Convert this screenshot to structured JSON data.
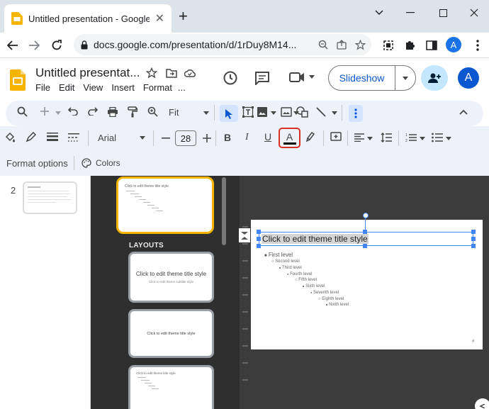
{
  "browser": {
    "tab_title": "Untitled presentation - Google Sl",
    "url": "docs.google.com/presentation/d/1rDuy8M14...",
    "avatar_letter": "A"
  },
  "docs": {
    "title": "Untitled presentat...",
    "menu": [
      "File",
      "Edit",
      "View",
      "Insert",
      "Format",
      "..."
    ],
    "slideshow_label": "Slideshow",
    "avatar_letter": "A"
  },
  "toolbar": {
    "zoom": "Fit",
    "font": "Arial",
    "font_size": "28"
  },
  "format_bar": {
    "format_options": "Format options",
    "colors": "Colors"
  },
  "filmstrip": {
    "slide_number": "2"
  },
  "master_panel": {
    "layouts_heading": "LAYOUTS",
    "layout1_title": "Click to edit theme title style",
    "layout1_subtitle": "Click to edit theme subtitle style",
    "layout2_title": "Click to edit theme title style",
    "theme_thumb_title": "Click to edit theme title style"
  },
  "slide": {
    "title": "Click to edit theme title style",
    "levels": [
      "First level",
      "Second level",
      "Third level",
      "Fourth level",
      "Fifth level",
      "Sixth level",
      "Seventh level",
      "Eighth level",
      "Ninth level"
    ],
    "page_number": "#"
  },
  "colors": {
    "accent_blue": "#0b57d0",
    "highlight_red": "#d93025",
    "selected_yellow": "#f4b400",
    "selection_blue": "#4285f4"
  }
}
